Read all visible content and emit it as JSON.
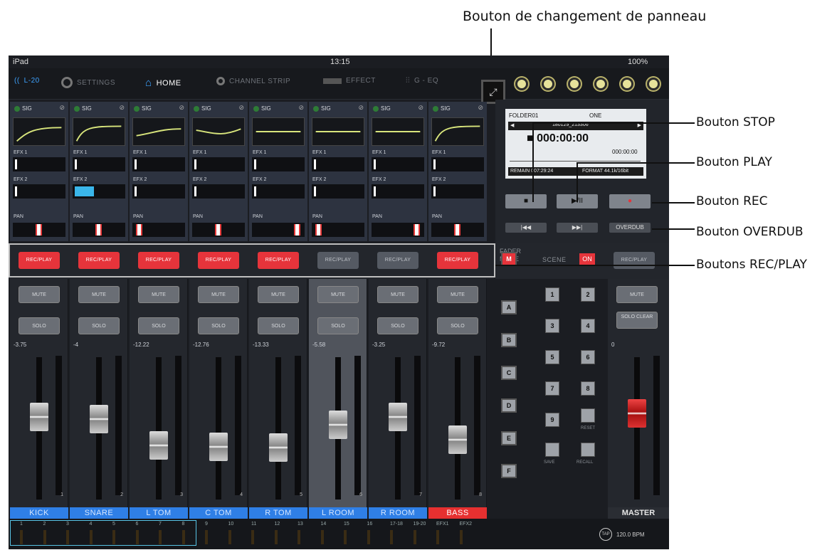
{
  "annotations": {
    "panel_switch": "Bouton de changement de panneau",
    "stop": "Bouton STOP",
    "play": "Bouton PLAY",
    "rec": "Bouton REC",
    "overdub": "Bouton OVERDUB",
    "recplay": "Boutons REC/PLAY"
  },
  "status": {
    "device": "iPad",
    "time": "13:15",
    "battery": "100%"
  },
  "nav": {
    "brand": "L-20",
    "settings": "SETTINGS",
    "home": "HOME",
    "channel_strip": "CHANNEL STRIP",
    "effect": "EFFECT",
    "geq": "G - EQ"
  },
  "knobs": [
    "A",
    "B",
    "C",
    "D",
    "E",
    "F"
  ],
  "channels": [
    {
      "name": "KICK",
      "level": "-3.75",
      "num": "1",
      "rec": true,
      "name_color": "#2f7fe6",
      "efx2": 0.0,
      "pan": 0.5,
      "fader": 0.6
    },
    {
      "name": "SNARE",
      "level": "-4",
      "num": "2",
      "rec": true,
      "name_color": "#2f7fe6",
      "efx2": 0.4,
      "pan": 0.5,
      "fader": 0.58
    },
    {
      "name": "L TOM",
      "level": "-12.22",
      "num": "3",
      "rec": true,
      "name_color": "#2f7fe6",
      "efx2": 0.0,
      "pan": 0.05,
      "fader": 0.35
    },
    {
      "name": "C TOM",
      "level": "-12.76",
      "num": "4",
      "rec": true,
      "name_color": "#2f7fe6",
      "efx2": 0.0,
      "pan": 0.5,
      "fader": 0.34
    },
    {
      "name": "R TOM",
      "level": "-13.33",
      "num": "5",
      "rec": true,
      "name_color": "#2f7fe6",
      "efx2": 0.0,
      "pan": 0.95,
      "fader": 0.33
    },
    {
      "name": "L ROOM",
      "level": "-5.58",
      "num": "6",
      "rec": false,
      "name_color": "#2f7fe6",
      "efx2": 0.0,
      "pan": 0.05,
      "fader": 0.53
    },
    {
      "name": "R ROOM",
      "level": "-3.25",
      "num": "7",
      "rec": false,
      "name_color": "#2f7fe6",
      "efx2": 0.0,
      "pan": 0.95,
      "fader": 0.6
    },
    {
      "name": "BASS",
      "level": "-9.72",
      "num": "8",
      "rec": true,
      "name_color": "#e63030",
      "efx2": 0.0,
      "pan": 0.5,
      "fader": 0.4
    }
  ],
  "labels": {
    "sig": "SIG",
    "efx1": "EFX 1",
    "efx2": "EFX 2",
    "pan": "PAN",
    "recplay": "REC/PLAY",
    "mute": "MUTE",
    "solo": "SOLO"
  },
  "recorder": {
    "folder": "FOLDER01",
    "mode": "ONE",
    "file": "180129_213306",
    "time": "000:00:00",
    "time_small": "000:00:00",
    "remain": "REMAIN 007:29:24",
    "format": "FORMAT 44.1k/16bit",
    "stop": "■",
    "play": "▶/II",
    "rec": "●",
    "rew": "|◀◀",
    "ff": "▶▶|",
    "overdub": "OVERDUB"
  },
  "right": {
    "fader_mode": "FADER MODE",
    "scene": "SCENE",
    "on": "ON",
    "modes": [
      "M",
      "A",
      "B",
      "C",
      "D",
      "E",
      "F"
    ],
    "scene_buttons": [
      "1",
      "2",
      "3",
      "4",
      "5",
      "6",
      "7",
      "8",
      "9"
    ],
    "reset": "RESET",
    "save": "SAVE",
    "recall": "RECALL",
    "master_recplay": "REC/PLAY",
    "master_mute": "MUTE",
    "solo_clear": "SOLO CLEAR",
    "master_level": "0",
    "master_name": "MASTER",
    "master_fader": 0.63
  },
  "bottom": {
    "channels": [
      "1",
      "2",
      "3",
      "4",
      "5",
      "6",
      "7",
      "8",
      "9",
      "10",
      "11",
      "12",
      "13",
      "14",
      "15",
      "16",
      "17-18",
      "19-20",
      "EFX1",
      "EFX2"
    ],
    "tap": "TAP",
    "bpm": "120.0 BPM"
  }
}
